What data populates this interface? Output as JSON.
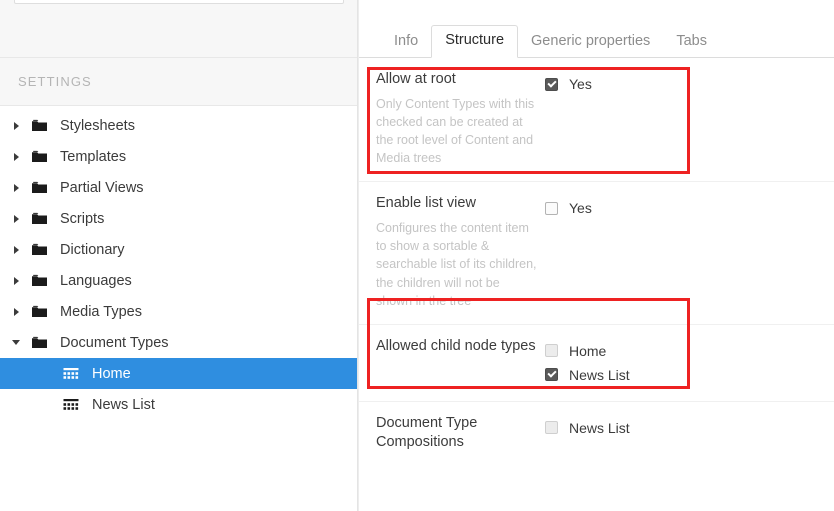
{
  "sidebar": {
    "search": {
      "placeholder": ""
    },
    "section_title": "SETTINGS",
    "items": [
      {
        "label": "Stylesheets",
        "icon": "folder-icon",
        "caret": "right",
        "selected": false,
        "level": 0
      },
      {
        "label": "Templates",
        "icon": "folder-icon",
        "caret": "right",
        "selected": false,
        "level": 0
      },
      {
        "label": "Partial Views",
        "icon": "folder-icon",
        "caret": "right",
        "selected": false,
        "level": 0
      },
      {
        "label": "Scripts",
        "icon": "folder-icon",
        "caret": "right",
        "selected": false,
        "level": 0
      },
      {
        "label": "Dictionary",
        "icon": "folder-icon",
        "caret": "right",
        "selected": false,
        "level": 0
      },
      {
        "label": "Languages",
        "icon": "folder-icon",
        "caret": "right",
        "selected": false,
        "level": 0
      },
      {
        "label": "Media Types",
        "icon": "folder-icon",
        "caret": "right",
        "selected": false,
        "level": 0
      },
      {
        "label": "Document Types",
        "icon": "folder-icon",
        "caret": "down",
        "selected": false,
        "level": 0
      },
      {
        "label": "Home",
        "icon": "doctype-grid-icon",
        "caret": "none",
        "selected": true,
        "level": 1
      },
      {
        "label": "News List",
        "icon": "doctype-grid-icon",
        "caret": "none",
        "selected": false,
        "level": 1
      }
    ]
  },
  "tabs": [
    {
      "label": "Info",
      "active": false
    },
    {
      "label": "Structure",
      "active": true
    },
    {
      "label": "Generic properties",
      "active": false
    },
    {
      "label": "Tabs",
      "active": false
    }
  ],
  "properties": [
    {
      "title": "Allow at root",
      "description": "Only Content Types with this checked can be created at the root level of Content and Media trees",
      "options": [
        {
          "label": "Yes",
          "checked": true,
          "muted": false
        }
      ]
    },
    {
      "title": "Enable list view",
      "description": "Configures the content item to show a sortable & searchable list of its children, the children will not be shown in the tree",
      "options": [
        {
          "label": "Yes",
          "checked": false,
          "muted": false
        }
      ]
    },
    {
      "title": "Allowed child node types",
      "description": "",
      "options": [
        {
          "label": "Home",
          "checked": false,
          "muted": true
        },
        {
          "label": "News List",
          "checked": true,
          "muted": false
        }
      ]
    },
    {
      "title": "Document Type Compositions",
      "description": "",
      "options": [
        {
          "label": "News List",
          "checked": false,
          "muted": true
        }
      ]
    }
  ],
  "annotations": [
    {
      "name": "allow-at-root-highlight",
      "color": "#ee2222"
    },
    {
      "name": "allowed-child-node-types-highlight",
      "color": "#ee2222"
    }
  ]
}
